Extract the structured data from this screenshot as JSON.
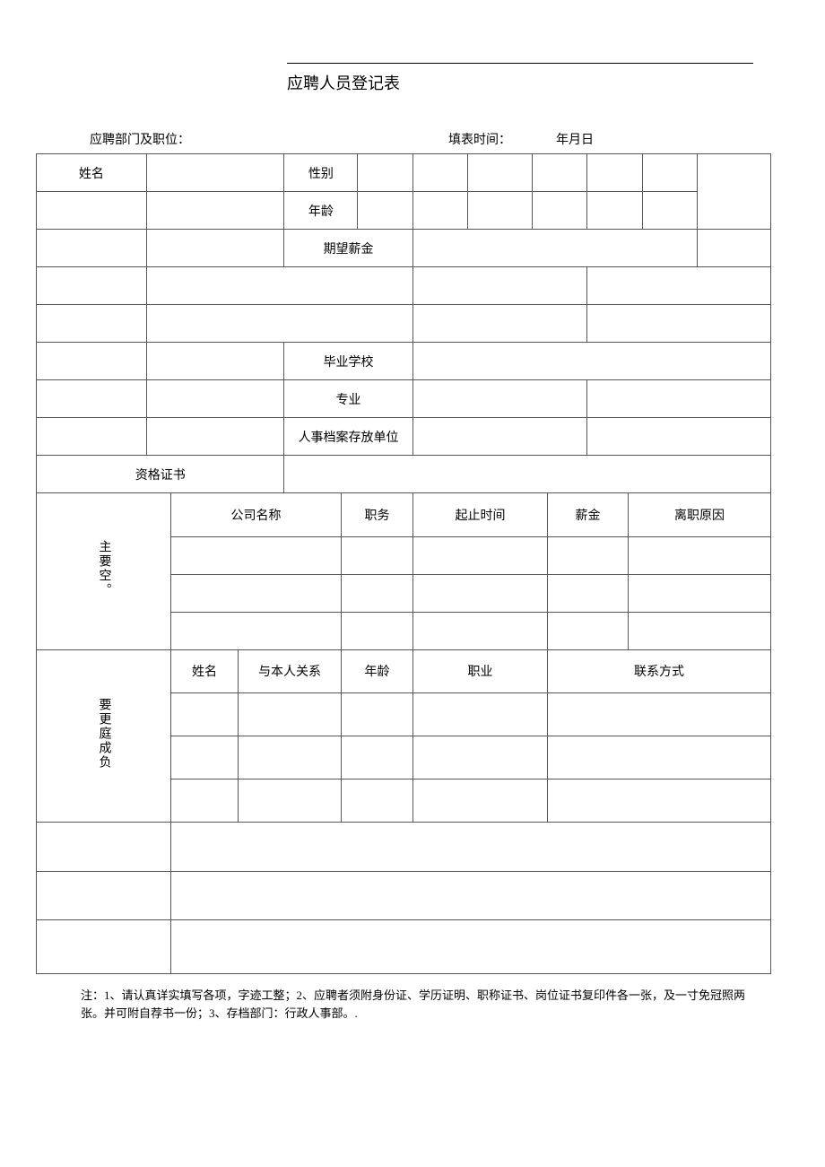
{
  "title": "应聘人员登记表",
  "header": {
    "position_label": "应聘部门及职位：",
    "date_label": "填表时间：",
    "date_value": "年月日"
  },
  "labels": {
    "name": "姓名",
    "gender": "性别",
    "age": "年龄",
    "expected_salary": "期望薪金",
    "grad_school": "毕业学校",
    "major": "专业",
    "archive_unit": "人事档案存放单位",
    "certificates": "资格证书",
    "work_section": "主要空。",
    "company": "公司名称",
    "duty": "职务",
    "period": "起止时间",
    "salary": "薪金",
    "leave_reason": "离职原因",
    "family_section": "要更庭成负",
    "family_name": "姓名",
    "relation": "与本人关系",
    "family_age": "年龄",
    "occupation": "职业",
    "contact": "联系方式"
  },
  "note": "注：1、请认真详实填写各项，字迹工整；2、应聘者须附身份证、学历证明、职称证书、岗位证书复印件各一张，及一寸免冠照两张。并可附自荐书一份；3、存档部门：行政人事部。."
}
